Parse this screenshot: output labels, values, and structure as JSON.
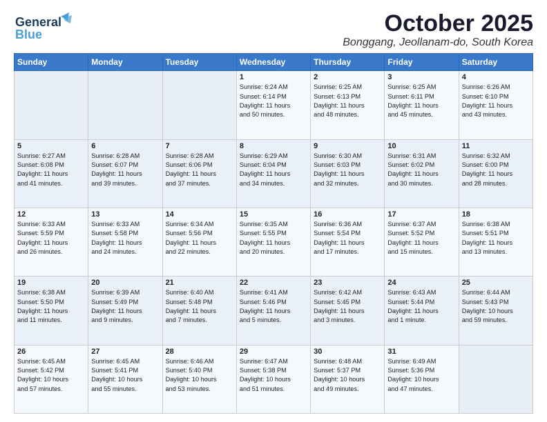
{
  "logo": {
    "line1": "General",
    "line2": "Blue"
  },
  "title": "October 2025",
  "subtitle": "Bonggang, Jeollanam-do, South Korea",
  "days_of_week": [
    "Sunday",
    "Monday",
    "Tuesday",
    "Wednesday",
    "Thursday",
    "Friday",
    "Saturday"
  ],
  "weeks": [
    [
      {
        "day": "",
        "info": ""
      },
      {
        "day": "",
        "info": ""
      },
      {
        "day": "",
        "info": ""
      },
      {
        "day": "1",
        "info": "Sunrise: 6:24 AM\nSunset: 6:14 PM\nDaylight: 11 hours\nand 50 minutes."
      },
      {
        "day": "2",
        "info": "Sunrise: 6:25 AM\nSunset: 6:13 PM\nDaylight: 11 hours\nand 48 minutes."
      },
      {
        "day": "3",
        "info": "Sunrise: 6:25 AM\nSunset: 6:11 PM\nDaylight: 11 hours\nand 45 minutes."
      },
      {
        "day": "4",
        "info": "Sunrise: 6:26 AM\nSunset: 6:10 PM\nDaylight: 11 hours\nand 43 minutes."
      }
    ],
    [
      {
        "day": "5",
        "info": "Sunrise: 6:27 AM\nSunset: 6:08 PM\nDaylight: 11 hours\nand 41 minutes."
      },
      {
        "day": "6",
        "info": "Sunrise: 6:28 AM\nSunset: 6:07 PM\nDaylight: 11 hours\nand 39 minutes."
      },
      {
        "day": "7",
        "info": "Sunrise: 6:28 AM\nSunset: 6:06 PM\nDaylight: 11 hours\nand 37 minutes."
      },
      {
        "day": "8",
        "info": "Sunrise: 6:29 AM\nSunset: 6:04 PM\nDaylight: 11 hours\nand 34 minutes."
      },
      {
        "day": "9",
        "info": "Sunrise: 6:30 AM\nSunset: 6:03 PM\nDaylight: 11 hours\nand 32 minutes."
      },
      {
        "day": "10",
        "info": "Sunrise: 6:31 AM\nSunset: 6:02 PM\nDaylight: 11 hours\nand 30 minutes."
      },
      {
        "day": "11",
        "info": "Sunrise: 6:32 AM\nSunset: 6:00 PM\nDaylight: 11 hours\nand 28 minutes."
      }
    ],
    [
      {
        "day": "12",
        "info": "Sunrise: 6:33 AM\nSunset: 5:59 PM\nDaylight: 11 hours\nand 26 minutes."
      },
      {
        "day": "13",
        "info": "Sunrise: 6:33 AM\nSunset: 5:58 PM\nDaylight: 11 hours\nand 24 minutes."
      },
      {
        "day": "14",
        "info": "Sunrise: 6:34 AM\nSunset: 5:56 PM\nDaylight: 11 hours\nand 22 minutes."
      },
      {
        "day": "15",
        "info": "Sunrise: 6:35 AM\nSunset: 5:55 PM\nDaylight: 11 hours\nand 20 minutes."
      },
      {
        "day": "16",
        "info": "Sunrise: 6:36 AM\nSunset: 5:54 PM\nDaylight: 11 hours\nand 17 minutes."
      },
      {
        "day": "17",
        "info": "Sunrise: 6:37 AM\nSunset: 5:52 PM\nDaylight: 11 hours\nand 15 minutes."
      },
      {
        "day": "18",
        "info": "Sunrise: 6:38 AM\nSunset: 5:51 PM\nDaylight: 11 hours\nand 13 minutes."
      }
    ],
    [
      {
        "day": "19",
        "info": "Sunrise: 6:38 AM\nSunset: 5:50 PM\nDaylight: 11 hours\nand 11 minutes."
      },
      {
        "day": "20",
        "info": "Sunrise: 6:39 AM\nSunset: 5:49 PM\nDaylight: 11 hours\nand 9 minutes."
      },
      {
        "day": "21",
        "info": "Sunrise: 6:40 AM\nSunset: 5:48 PM\nDaylight: 11 hours\nand 7 minutes."
      },
      {
        "day": "22",
        "info": "Sunrise: 6:41 AM\nSunset: 5:46 PM\nDaylight: 11 hours\nand 5 minutes."
      },
      {
        "day": "23",
        "info": "Sunrise: 6:42 AM\nSunset: 5:45 PM\nDaylight: 11 hours\nand 3 minutes."
      },
      {
        "day": "24",
        "info": "Sunrise: 6:43 AM\nSunset: 5:44 PM\nDaylight: 11 hours\nand 1 minute."
      },
      {
        "day": "25",
        "info": "Sunrise: 6:44 AM\nSunset: 5:43 PM\nDaylight: 10 hours\nand 59 minutes."
      }
    ],
    [
      {
        "day": "26",
        "info": "Sunrise: 6:45 AM\nSunset: 5:42 PM\nDaylight: 10 hours\nand 57 minutes."
      },
      {
        "day": "27",
        "info": "Sunrise: 6:45 AM\nSunset: 5:41 PM\nDaylight: 10 hours\nand 55 minutes."
      },
      {
        "day": "28",
        "info": "Sunrise: 6:46 AM\nSunset: 5:40 PM\nDaylight: 10 hours\nand 53 minutes."
      },
      {
        "day": "29",
        "info": "Sunrise: 6:47 AM\nSunset: 5:38 PM\nDaylight: 10 hours\nand 51 minutes."
      },
      {
        "day": "30",
        "info": "Sunrise: 6:48 AM\nSunset: 5:37 PM\nDaylight: 10 hours\nand 49 minutes."
      },
      {
        "day": "31",
        "info": "Sunrise: 6:49 AM\nSunset: 5:36 PM\nDaylight: 10 hours\nand 47 minutes."
      },
      {
        "day": "",
        "info": ""
      }
    ]
  ]
}
